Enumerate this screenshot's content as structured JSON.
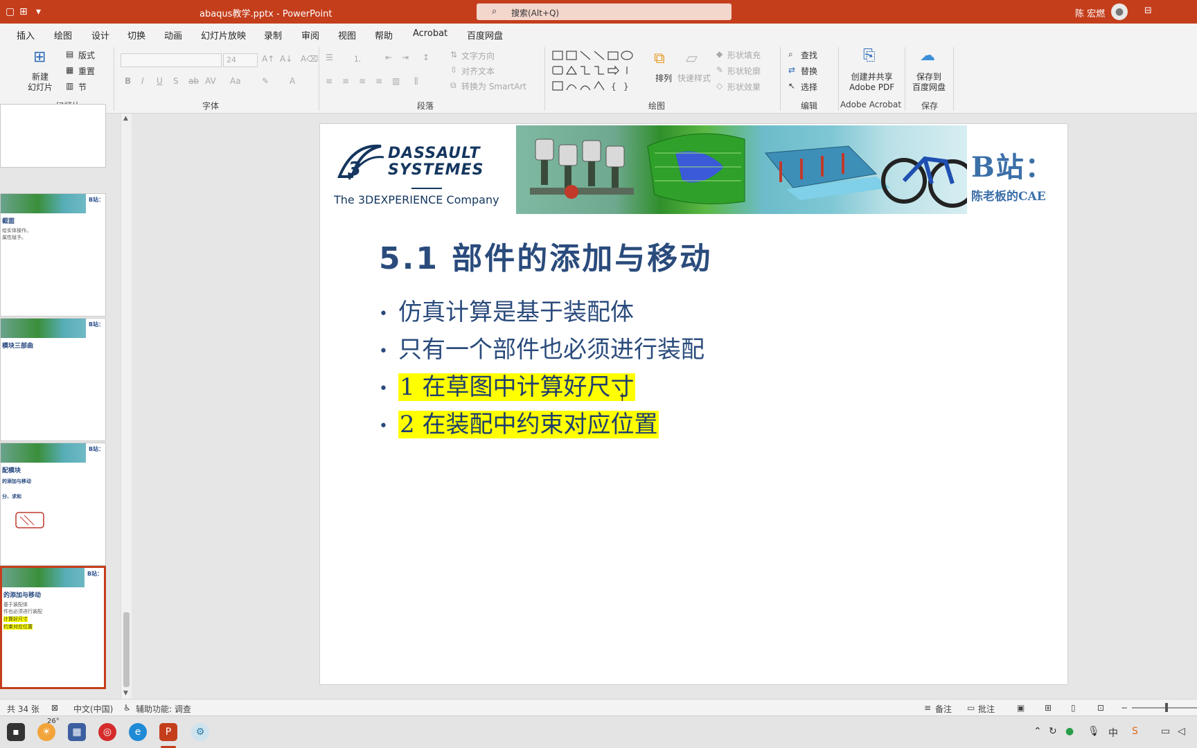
{
  "window": {
    "title": "abaqus教学.pptx  -  PowerPoint",
    "search_placeholder": "搜索(Alt+Q)",
    "user": "陈 宏燃"
  },
  "menu_tabs": [
    "插入",
    "绘图",
    "设计",
    "切换",
    "动画",
    "幻灯片放映",
    "录制",
    "审阅",
    "视图",
    "帮助",
    "Acrobat",
    "百度网盘"
  ],
  "ribbon": {
    "slides_group": {
      "new_slide": "新建\n幻灯片",
      "layout": "版式",
      "reset": "重置",
      "section": "节",
      "label": "幻灯片"
    },
    "font_group": {
      "font_size": "24",
      "label": "字体"
    },
    "paragraph_group": {
      "text_direction": "文字方向",
      "align_text": "对齐文本",
      "convert_smartart": "转换为 SmartArt",
      "label": "段落"
    },
    "drawing_group": {
      "arrange": "排列",
      "quick_styles": "快速样式",
      "shape_fill": "形状填充",
      "shape_outline": "形状轮廓",
      "shape_effects": "形状效果",
      "label": "绘图"
    },
    "editing_group": {
      "find": "查找",
      "replace": "替换",
      "select": "选择",
      "label": "编辑"
    },
    "acrobat_group": {
      "create_share": "创建并共享\nAdobe PDF",
      "label": "Adobe Acrobat"
    },
    "save_group": {
      "save_baidu": "保存到\n百度网盘",
      "label": "保存"
    }
  },
  "thumbnails": [
    {
      "title": "",
      "lines": []
    },
    {
      "title": "截面",
      "lines": [
        "给实体操作。",
        "属性赋予。"
      ]
    },
    {
      "title": "模块三部曲",
      "lines": []
    },
    {
      "title": "配模块",
      "lines": [
        "的添加与移动",
        "分、求和"
      ]
    },
    {
      "title": "的添加与移动",
      "lines": [
        "基于装配体",
        "件也必须进行装配",
        "计算好尺寸",
        "约束对应位置"
      ]
    }
  ],
  "slide": {
    "logo_line1": "DASSAULT",
    "logo_line2": "SYSTEMES",
    "logo_company": "The 3DEXPERIENCE Company",
    "badge_line1": "B站：",
    "badge_line2": "陈老板的CAE",
    "title": "5.1 部件的添加与移动",
    "bullets": [
      {
        "text": "仿真计算是基于装配体",
        "highlight": false
      },
      {
        "text": "只有一个部件也必须进行装配",
        "highlight": false
      },
      {
        "text": "1 在草图中计算好尺寸",
        "highlight": true
      },
      {
        "text": "2 在装配中约束对应位置",
        "highlight": true
      }
    ]
  },
  "statusbar": {
    "slide_count": "共 34 张",
    "language": "中文(中国)",
    "accessibility": "辅助功能: 调查",
    "notes": "备注",
    "comments": "批注"
  },
  "taskbar": {
    "weather": "26°"
  },
  "colors": {
    "accent": "#c43e1c",
    "slide_text": "#2a4b7c",
    "highlight": "#ffff00"
  }
}
